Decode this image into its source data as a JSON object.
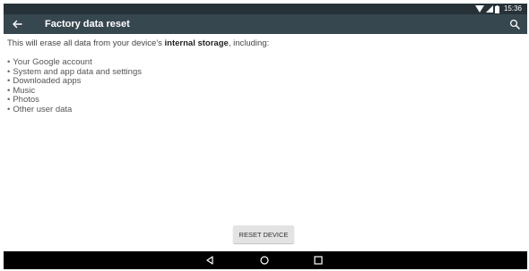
{
  "status_bar": {
    "time": "15:36",
    "icons": [
      "wifi-icon",
      "signal-icon",
      "battery-icon"
    ]
  },
  "app_bar": {
    "title": "Factory data reset",
    "back_icon": "arrow-back-icon",
    "search_icon": "search-icon"
  },
  "content": {
    "intro_prefix": "This will erase all data from your device's ",
    "intro_bold": "internal storage",
    "intro_suffix": ", including:",
    "items": [
      "Your Google account",
      "System and app data and settings",
      "Downloaded apps",
      "Music",
      "Photos",
      "Other user data"
    ]
  },
  "reset_button": {
    "label": "RESET DEVICE"
  },
  "nav_bar": {
    "buttons": [
      "back-nav-icon",
      "home-icon",
      "recents-icon"
    ]
  },
  "colors": {
    "status_bar": "#263238",
    "app_bar": "#37474f",
    "nav_bar": "#000000",
    "button": "#e3e3e3"
  }
}
